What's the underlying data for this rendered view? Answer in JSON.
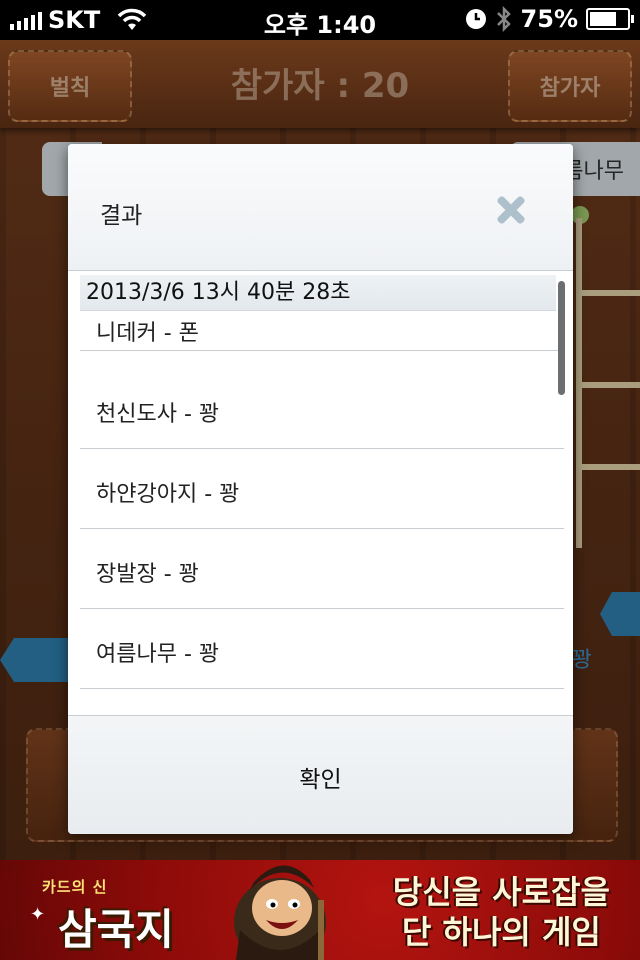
{
  "status_bar": {
    "carrier": "SKT",
    "time": "오후 1:40",
    "battery_percent": "75%",
    "battery_level": 0.75
  },
  "nav": {
    "left_button": "벌칙",
    "title": "참가자 : 20",
    "right_button": "참가자"
  },
  "background": {
    "tab_label": "름나무",
    "right_label": "꽝"
  },
  "dialog": {
    "title": "결과",
    "timestamp": "2013/3/6  13시 40분 28초",
    "results": [
      "니데커 - 폰",
      "천신도사 - 꽝",
      "하얀강아지 - 꽝",
      "장발장 - 꽝",
      "여름나무 - 꽝"
    ],
    "confirm_label": "확인"
  },
  "banner": {
    "small_text": "카드의 신",
    "title": "삼국지",
    "slogan_line1": "당신을 사로잡을",
    "slogan_line2": "단 하나의 게임"
  },
  "colors": {
    "wood": "#6c3a1d",
    "banner_red": "#a31210",
    "dialog_bg": "#f4f6f8"
  }
}
